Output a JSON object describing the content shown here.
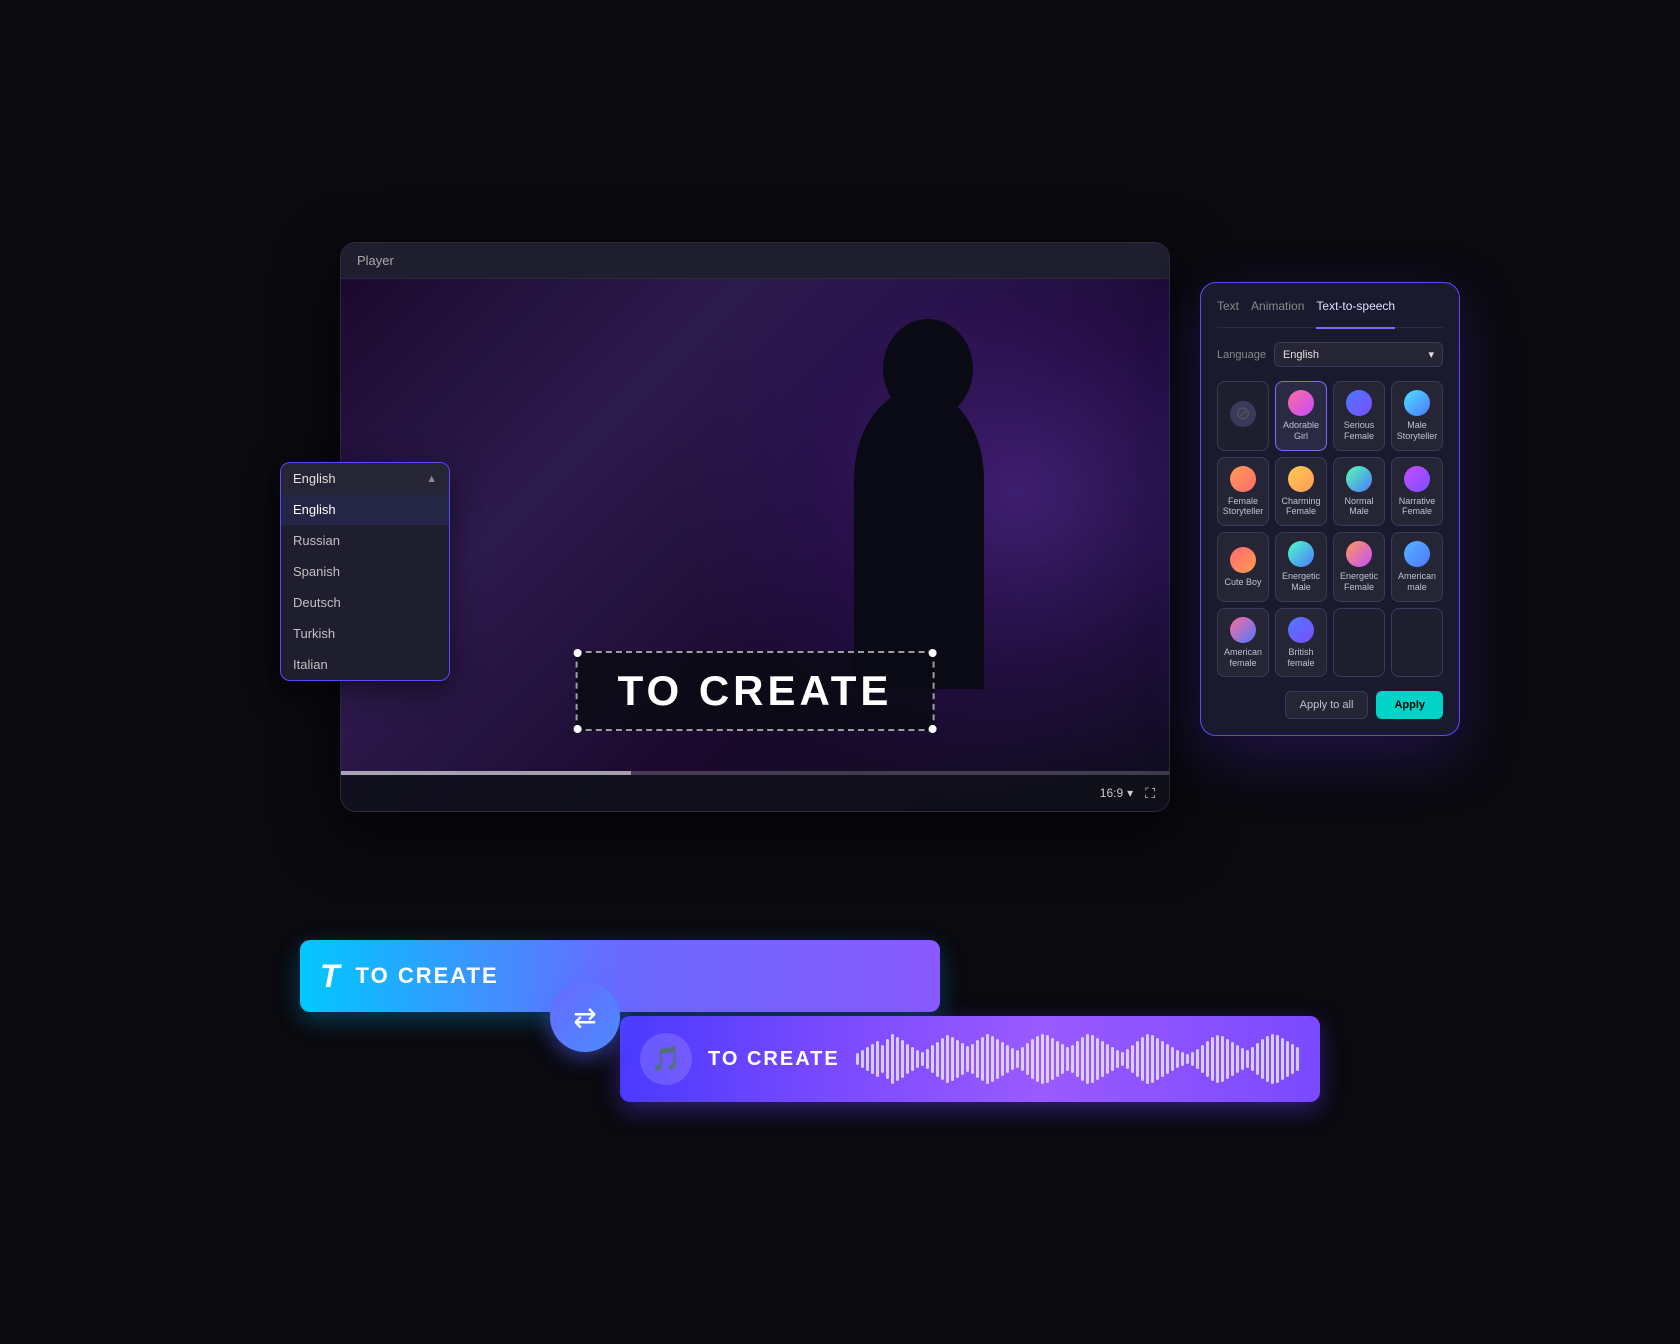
{
  "player": {
    "title": "Player",
    "video_text": "TO CREATE",
    "aspect_ratio": "16:9"
  },
  "language_dropdown": {
    "selected": "English",
    "items": [
      "English",
      "Russian",
      "Spanish",
      "Deutsch",
      "Turkish",
      "Italian"
    ]
  },
  "tts_panel": {
    "tabs": [
      "Text",
      "Animation",
      "Text-to-speech"
    ],
    "active_tab": "Text-to-speech",
    "language_label": "Language",
    "language_value": "English",
    "voices": [
      {
        "id": "disabled",
        "name": "",
        "avatar_class": "disabled"
      },
      {
        "id": "adorable-girl",
        "name": "Adorable Girl",
        "avatar_class": "female-1",
        "selected": true
      },
      {
        "id": "serious-female",
        "name": "Serious Female",
        "avatar_class": "female-2"
      },
      {
        "id": "male-storyteller",
        "name": "Male Storyteller",
        "avatar_class": "male-1"
      },
      {
        "id": "female-storyteller",
        "name": "Female Storyteller",
        "avatar_class": "female-3"
      },
      {
        "id": "charming-female",
        "name": "Charming Female",
        "avatar_class": "female-4"
      },
      {
        "id": "normal-male",
        "name": "Normal Male",
        "avatar_class": "male-2"
      },
      {
        "id": "narrative-female",
        "name": "Narrative Female",
        "avatar_class": "female-5"
      },
      {
        "id": "cute-boy",
        "name": "Cute Boy",
        "avatar_class": "male-3"
      },
      {
        "id": "energetic-male",
        "name": "Energetic Male",
        "avatar_class": "male-4"
      },
      {
        "id": "energetic-female",
        "name": "Energetic Female",
        "avatar_class": "female-6"
      },
      {
        "id": "american-male",
        "name": "American male",
        "avatar_class": "male-5"
      },
      {
        "id": "american-female",
        "name": "American female",
        "avatar_class": "female-7"
      },
      {
        "id": "british-female",
        "name": "British female",
        "avatar_class": "female-2"
      }
    ],
    "btn_apply_all": "Apply to all",
    "btn_apply": "Apply"
  },
  "timeline": {
    "text_bar_label": "TO CREATE",
    "audio_bar_label": "TO CREATE"
  }
}
